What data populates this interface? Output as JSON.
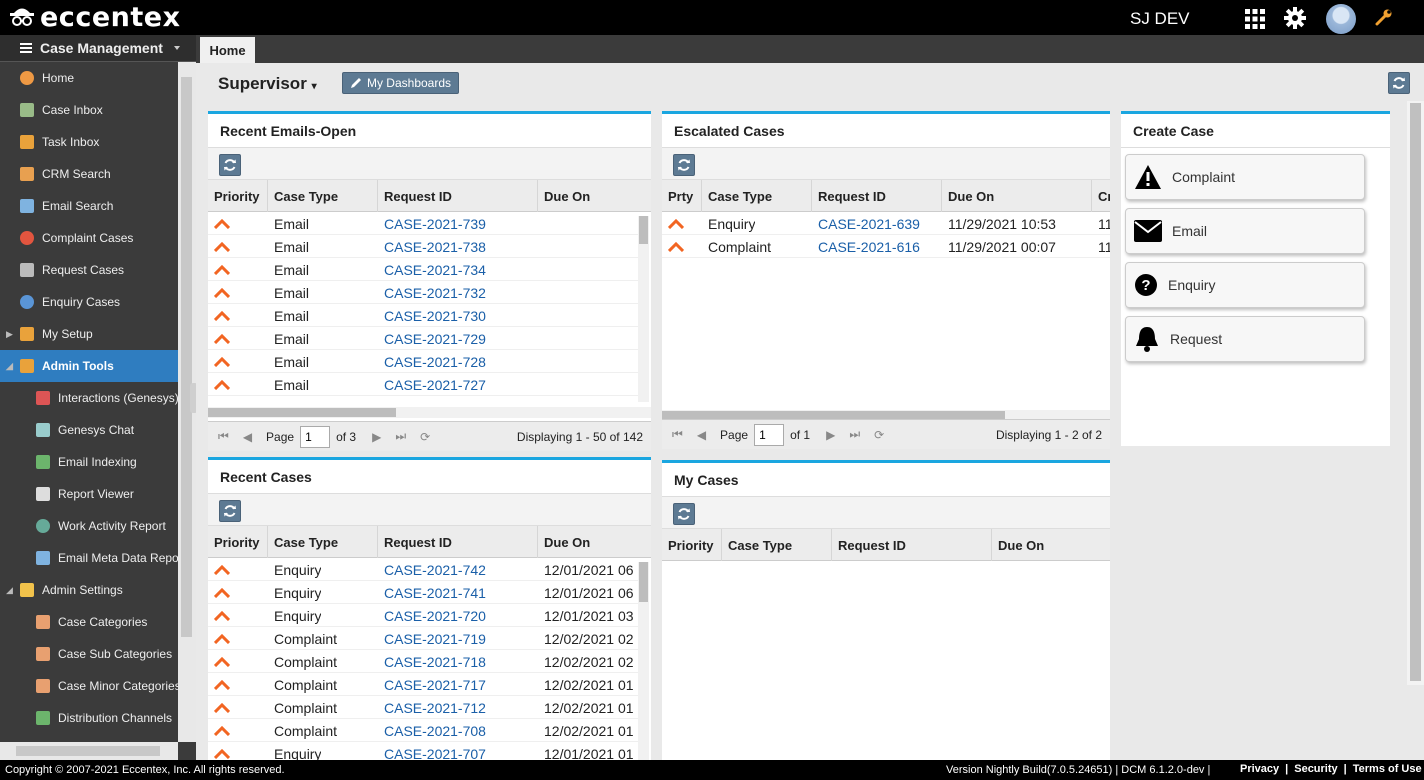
{
  "app": {
    "logo_text": "eccentex",
    "user_name": "SJ DEV"
  },
  "sidebar": {
    "header": "Case Management",
    "items": [
      {
        "label": "Home",
        "icon": "pie-chart-icon"
      },
      {
        "label": "Case Inbox",
        "icon": "inbox-icon"
      },
      {
        "label": "Task Inbox",
        "icon": "clipboard-icon"
      },
      {
        "label": "CRM Search",
        "icon": "people-search-icon"
      },
      {
        "label": "Email Search",
        "icon": "envelope-icon"
      },
      {
        "label": "Complaint Cases",
        "icon": "alert-circle-icon"
      },
      {
        "label": "Request Cases",
        "icon": "megaphone-icon"
      },
      {
        "label": "Enquiry Cases",
        "icon": "info-icon"
      },
      {
        "label": "My Setup",
        "icon": "wrench-icon"
      },
      {
        "label": "Admin Tools",
        "icon": "wrench-icon"
      },
      {
        "label": "Interactions (Genesys)",
        "icon": "phone-icon"
      },
      {
        "label": "Genesys Chat",
        "icon": "chat-icon"
      },
      {
        "label": "Email Indexing",
        "icon": "mail-index-icon"
      },
      {
        "label": "Report Viewer",
        "icon": "report-icon"
      },
      {
        "label": "Work Activity Report",
        "icon": "globe-icon"
      },
      {
        "label": "Email Meta Data Report",
        "icon": "envelope-icon"
      },
      {
        "label": "Admin Settings",
        "icon": "folder-icon"
      },
      {
        "label": "Case Categories",
        "icon": "tag-icon"
      },
      {
        "label": "Case Sub Categories",
        "icon": "tag-icon"
      },
      {
        "label": "Case Minor Categories",
        "icon": "tag-icon"
      },
      {
        "label": "Distribution Channels",
        "icon": "mail-index-icon"
      }
    ]
  },
  "tabs": [
    {
      "label": "Home"
    }
  ],
  "toolbar": {
    "role": "Supervisor",
    "dashboards_label": "My Dashboards"
  },
  "recent_emails": {
    "title": "Recent Emails-Open",
    "columns": [
      "Priority",
      "Case Type",
      "Request ID",
      "Due On"
    ],
    "rows": [
      {
        "type": "Email",
        "id": "CASE-2021-739",
        "due": ""
      },
      {
        "type": "Email",
        "id": "CASE-2021-738",
        "due": ""
      },
      {
        "type": "Email",
        "id": "CASE-2021-734",
        "due": ""
      },
      {
        "type": "Email",
        "id": "CASE-2021-732",
        "due": ""
      },
      {
        "type": "Email",
        "id": "CASE-2021-730",
        "due": ""
      },
      {
        "type": "Email",
        "id": "CASE-2021-729",
        "due": ""
      },
      {
        "type": "Email",
        "id": "CASE-2021-728",
        "due": ""
      },
      {
        "type": "Email",
        "id": "CASE-2021-727",
        "due": ""
      }
    ],
    "pager": {
      "page_label": "Page",
      "page": "1",
      "of": "of 3",
      "display": "Displaying 1 - 50 of 142"
    }
  },
  "escalated": {
    "title": "Escalated Cases",
    "columns": [
      "Prty",
      "Case Type",
      "Request ID",
      "Due On",
      "Cr"
    ],
    "rows": [
      {
        "type": "Enquiry",
        "id": "CASE-2021-639",
        "due": "11/29/2021 10:53",
        "cr": "11"
      },
      {
        "type": "Complaint",
        "id": "CASE-2021-616",
        "due": "11/29/2021 00:07",
        "cr": "11"
      }
    ],
    "pager": {
      "page_label": "Page",
      "page": "1",
      "of": "of 1",
      "display": "Displaying 1 - 2 of 2"
    }
  },
  "create_case": {
    "title": "Create Case",
    "buttons": [
      {
        "label": "Complaint",
        "icon": "warning-icon"
      },
      {
        "label": "Email",
        "icon": "envelope-icon"
      },
      {
        "label": "Enquiry",
        "icon": "question-icon"
      },
      {
        "label": "Request",
        "icon": "bell-icon"
      }
    ]
  },
  "recent_cases": {
    "title": "Recent Cases",
    "columns": [
      "Priority",
      "Case Type",
      "Request ID",
      "Due On"
    ],
    "rows": [
      {
        "type": "Enquiry",
        "id": "CASE-2021-742",
        "due": "12/01/2021 06"
      },
      {
        "type": "Enquiry",
        "id": "CASE-2021-741",
        "due": "12/01/2021 06"
      },
      {
        "type": "Enquiry",
        "id": "CASE-2021-720",
        "due": "12/01/2021 03"
      },
      {
        "type": "Complaint",
        "id": "CASE-2021-719",
        "due": "12/02/2021 02"
      },
      {
        "type": "Complaint",
        "id": "CASE-2021-718",
        "due": "12/02/2021 02"
      },
      {
        "type": "Complaint",
        "id": "CASE-2021-717",
        "due": "12/02/2021 01"
      },
      {
        "type": "Complaint",
        "id": "CASE-2021-712",
        "due": "12/02/2021 01"
      },
      {
        "type": "Complaint",
        "id": "CASE-2021-708",
        "due": "12/02/2021 01"
      },
      {
        "type": "Enquiry",
        "id": "CASE-2021-707",
        "due": "12/01/2021 01"
      }
    ]
  },
  "my_cases": {
    "title": "My Cases",
    "columns": [
      "Priority",
      "Case Type",
      "Request ID",
      "Due On"
    ]
  },
  "footer": {
    "copyright": "Copyright © 2007-2021 Eccentex, Inc. All rights reserved.",
    "version": "Version   Nightly Build(7.0.5.24651) | DCM 6.1.2.0-dev |",
    "links": [
      "Privacy",
      "Security",
      "Terms of Use"
    ]
  },
  "colors": {
    "accent": "#1aa6e0",
    "active_nav": "#2f7dc0",
    "priority": "#f26522",
    "link": "#1a5fa8"
  }
}
